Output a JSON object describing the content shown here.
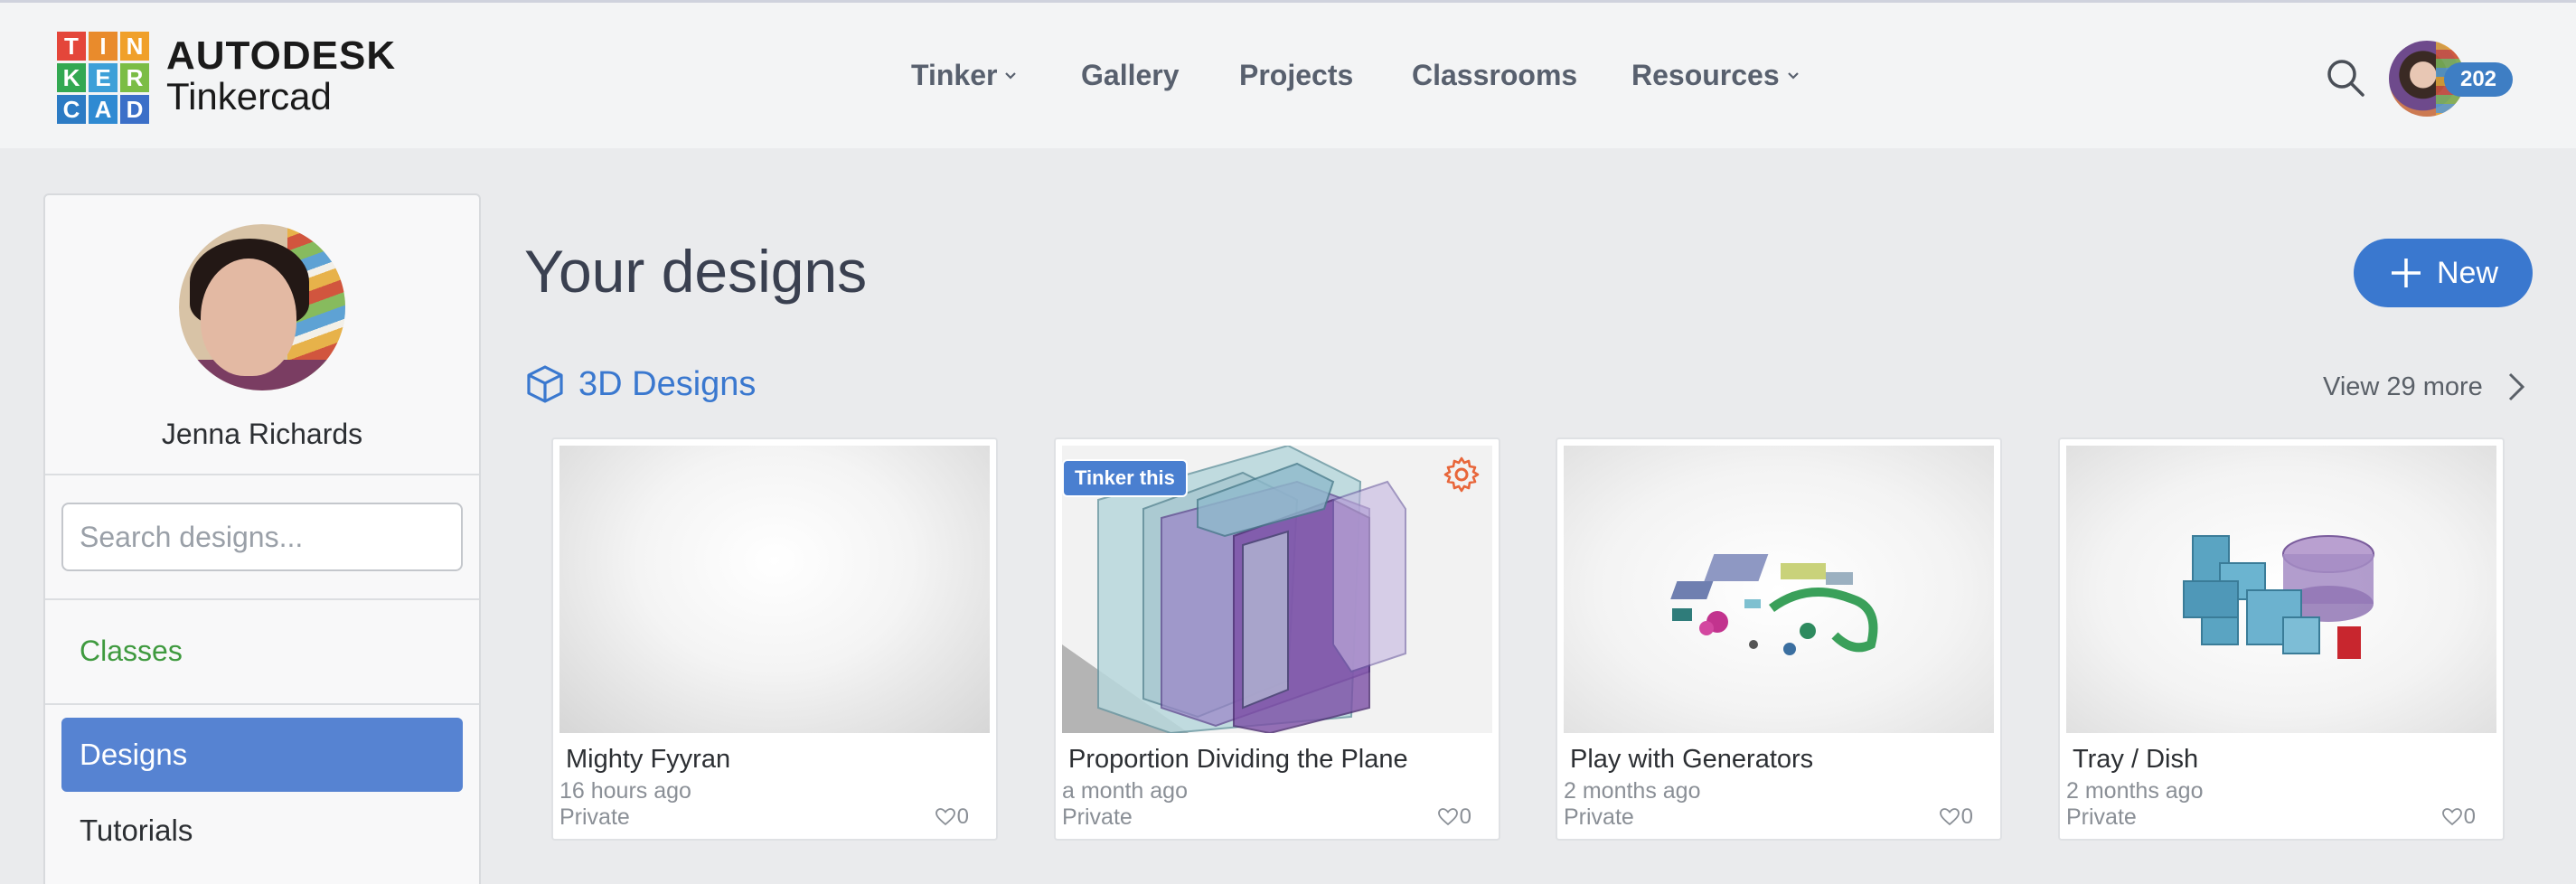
{
  "brand": {
    "logo_letters": [
      "T",
      "I",
      "N",
      "K",
      "E",
      "R",
      "C",
      "A",
      "D"
    ],
    "logo_colors": [
      "#e74c3c",
      "#e67e22",
      "#f39c12",
      "#27ae60",
      "#3498db",
      "#2ecc71",
      "#2980b9",
      "#1f78c1",
      "#3a7dd0"
    ],
    "company": "AUTODESK",
    "product": "Tinkercad"
  },
  "nav": {
    "items": [
      {
        "label": "Tinker",
        "has_dropdown": true
      },
      {
        "label": "Gallery",
        "has_dropdown": false
      },
      {
        "label": "Projects",
        "has_dropdown": false
      },
      {
        "label": "Classrooms",
        "has_dropdown": false
      },
      {
        "label": "Resources",
        "has_dropdown": true
      }
    ]
  },
  "user": {
    "badge_count": "202",
    "name": "Jenna Richards"
  },
  "sidebar": {
    "search_placeholder": "Search designs...",
    "classes_label": "Classes",
    "designs_label": "Designs",
    "tutorials_label": "Tutorials"
  },
  "main": {
    "title": "Your designs",
    "new_button_label": "New",
    "section_label": "3D Designs",
    "view_more_label": "View 29 more"
  },
  "designs": [
    {
      "title": "Mighty Fyyran",
      "time": "16 hours ago",
      "privacy": "Private",
      "likes": "0"
    },
    {
      "title": "Proportion Dividing the Plane",
      "time": "a month ago",
      "privacy": "Private",
      "likes": "0",
      "badge": "Tinker this"
    },
    {
      "title": "Play with Generators",
      "time": "2 months ago",
      "privacy": "Private",
      "likes": "0"
    },
    {
      "title": "Tray / Dish",
      "time": "2 months ago",
      "privacy": "Private",
      "likes": "0"
    }
  ],
  "colors": {
    "accent": "#3a78cf",
    "active_nav": "#5683d2",
    "classes_green": "#3f9a3f",
    "gear_orange": "#e8663a"
  }
}
